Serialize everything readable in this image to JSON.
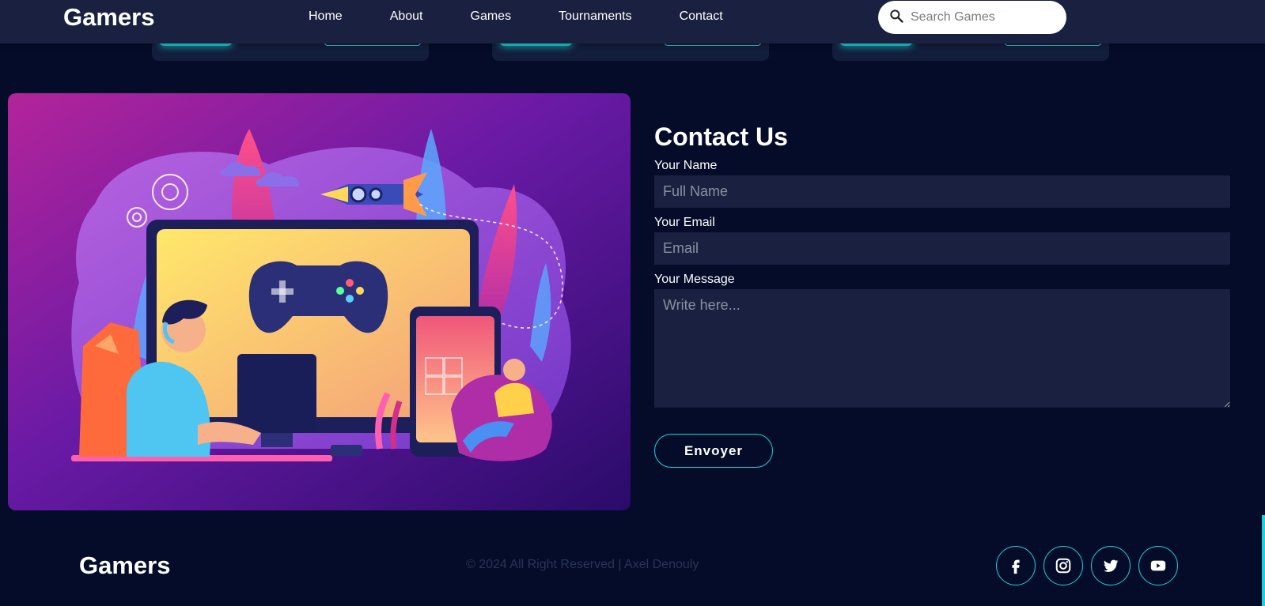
{
  "navbar": {
    "brand": "Gamers",
    "links": [
      "Home",
      "About",
      "Games",
      "Tournaments",
      "Contact"
    ],
    "search_placeholder": "Search Games"
  },
  "contact": {
    "title": "Contact Us",
    "name_label": "Your Name",
    "name_placeholder": "Full Name",
    "email_label": "Your Email",
    "email_placeholder": "Email",
    "message_label": "Your Message",
    "message_placeholder": "Write here...",
    "submit_label": "Envoyer"
  },
  "footer": {
    "brand": "Gamers",
    "copyright": "© 2024 All Right Reserved | Axel Denouly",
    "socials": [
      "facebook-icon",
      "instagram-icon",
      "twitter-icon",
      "youtube-icon"
    ]
  },
  "colors": {
    "background": "#040c29",
    "navbar": "#1a2140",
    "accent": "#1fd1d6",
    "input_bg": "#1a2140"
  }
}
